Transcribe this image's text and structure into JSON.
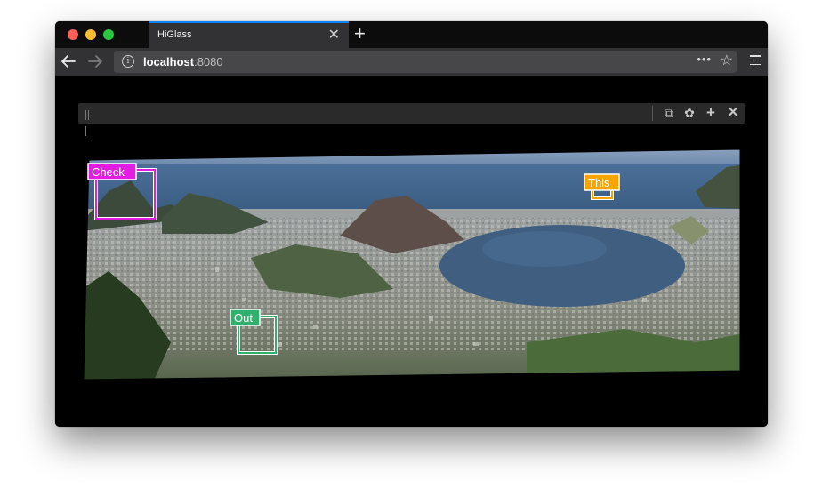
{
  "browser": {
    "tab_title": "HiGlass",
    "url_host": "localhost",
    "url_port": ":8080",
    "tab_close_glyph": "✕",
    "new_tab_glyph": "+",
    "page_actions_glyph": "•••",
    "bookmark_glyph": "☆",
    "icons": [
      "close-icon",
      "plus-icon",
      "back-arrow-icon",
      "forward-arrow-icon",
      "info-icon",
      "more-icon",
      "star-icon",
      "hamburger-menu-icon"
    ]
  },
  "higlass": {
    "toolbar_icons": [
      "drag-handle-icon",
      "copy-icon",
      "gear-icon",
      "plus-icon",
      "close-icon"
    ],
    "copy_glyph": "⧉",
    "gear_glyph": "✿",
    "add_glyph": "+",
    "close_glyph": "✕"
  },
  "annotations": [
    {
      "id": "check",
      "label": "Check",
      "color": "#e21ce0"
    },
    {
      "id": "this",
      "label": "This",
      "color": "#f7a300"
    },
    {
      "id": "out",
      "label": "Out",
      "color": "#2fb06f"
    }
  ],
  "colors": {
    "accent_tab": "#0a84ff",
    "traffic_red": "#fe5f57",
    "traffic_yellow": "#febc2e",
    "traffic_green": "#28c840"
  }
}
